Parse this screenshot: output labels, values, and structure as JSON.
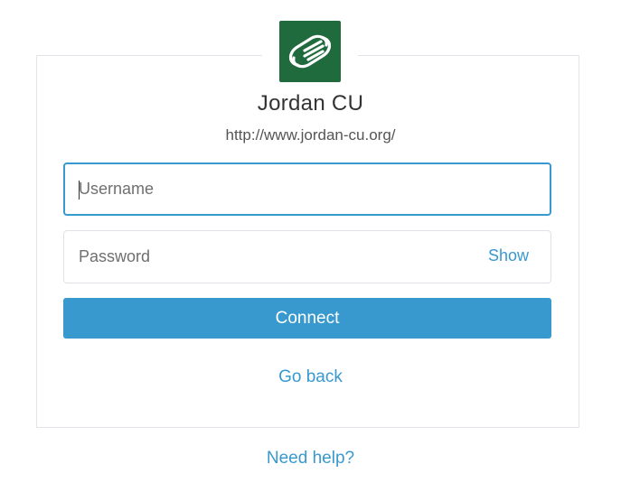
{
  "institution": {
    "name": "Jordan CU",
    "url": "http://www.jordan-cu.org/",
    "logo_icon": "linked-hands-icon",
    "logo_color": "#1f6b3e"
  },
  "form": {
    "username": {
      "placeholder": "Username",
      "value": ""
    },
    "password": {
      "placeholder": "Password",
      "value": "",
      "show_label": "Show"
    },
    "connect_label": "Connect",
    "go_back_label": "Go back"
  },
  "footer": {
    "help_label": "Need help?"
  },
  "colors": {
    "accent": "#3899cf",
    "border": "#e1e4e8",
    "text": "#333333"
  }
}
